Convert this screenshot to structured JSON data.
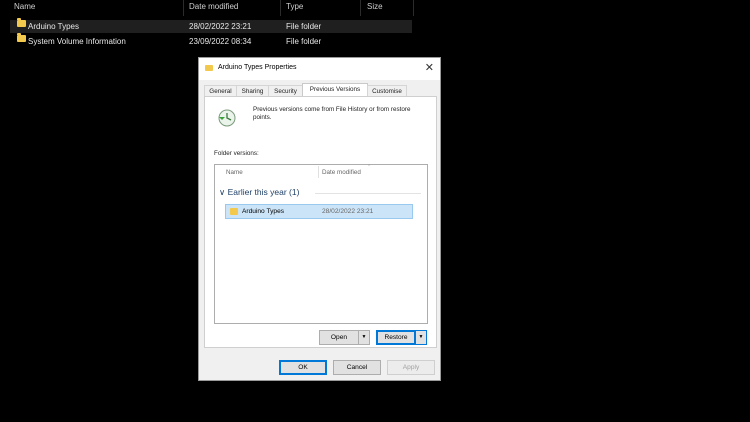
{
  "explorer": {
    "columns": {
      "name": "Name",
      "date": "Date modified",
      "type": "Type",
      "size": "Size"
    },
    "rows": [
      {
        "name": "Arduino Types",
        "date": "28/02/2022 23:21",
        "type": "File folder"
      },
      {
        "name": "System Volume Information",
        "date": "23/09/2022 08:34",
        "type": "File folder"
      }
    ]
  },
  "dialog": {
    "title": "Arduino Types Properties",
    "close_glyph": "✕",
    "tabs": [
      "General",
      "Sharing",
      "Security",
      "Previous Versions",
      "Customise"
    ],
    "active_tab": "Previous Versions",
    "info_text": "Previous versions come from File History or from restore points.",
    "folder_versions_label": "Folder versions:",
    "list": {
      "col_name": "Name",
      "col_date": "Date modified",
      "group": "Earlier this year (1)",
      "group_chevron": "∨",
      "item": {
        "name": "Arduino Types",
        "date": "28/02/2022 23:21"
      }
    },
    "open_button": "Open",
    "restore_button": "Restore",
    "split_glyph": "▼",
    "ok_button": "OK",
    "cancel_button": "Cancel",
    "apply_button": "Apply"
  },
  "icons": {
    "folder": "folder-icon",
    "history": "history-icon"
  },
  "colors": {
    "folder": "#f2c94c",
    "selection": "#cce4f7",
    "accent": "#0078d7"
  }
}
